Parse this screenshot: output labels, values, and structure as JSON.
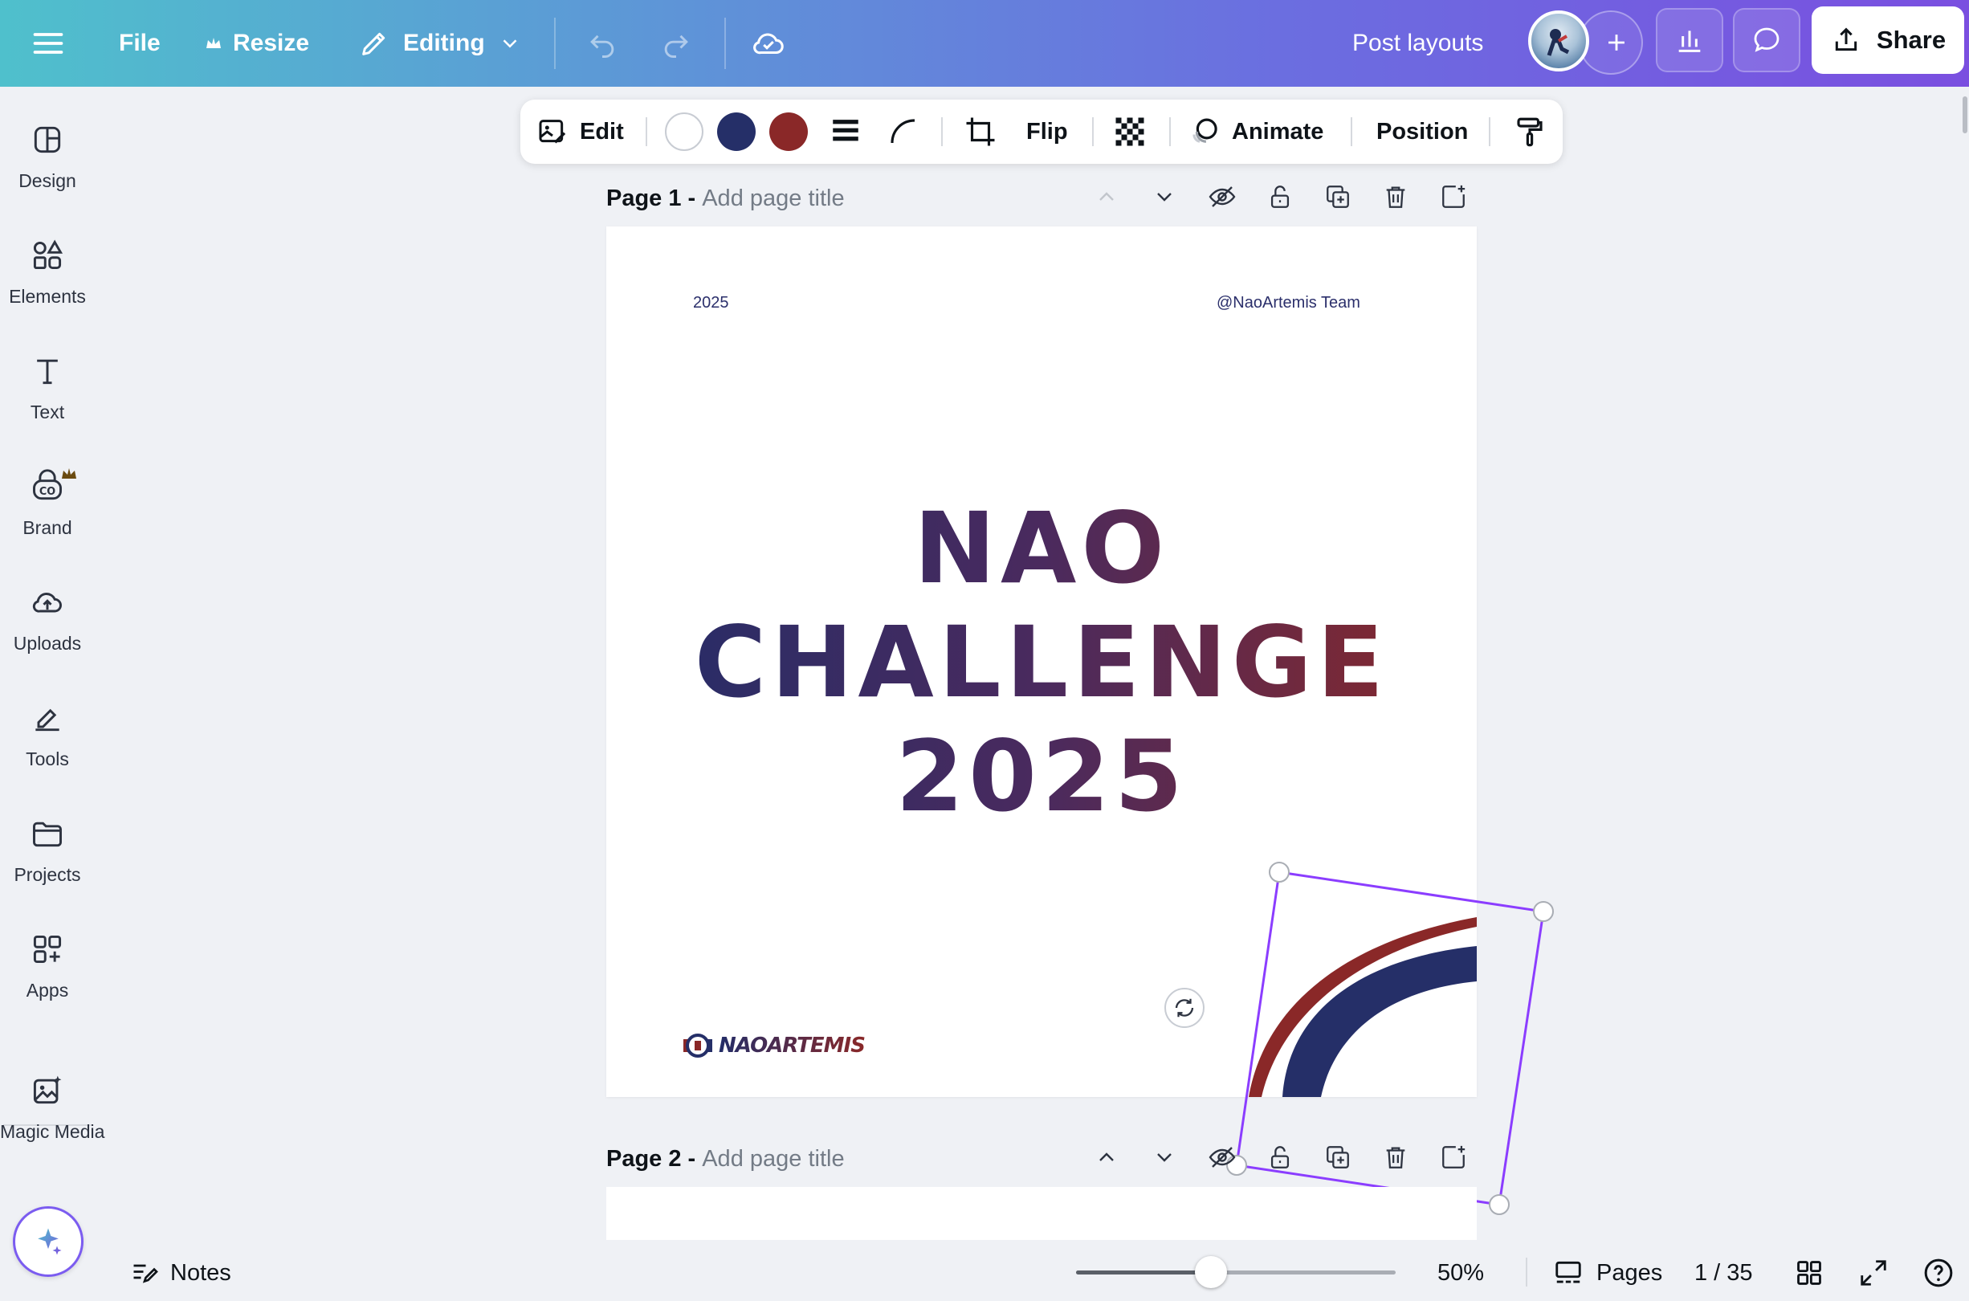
{
  "topbar": {
    "file_label": "File",
    "resize_label": "Resize",
    "editing_label": "Editing",
    "post_layouts_label": "Post layouts",
    "share_label": "Share"
  },
  "sidebar": {
    "items": [
      {
        "label": "Design",
        "icon": "design-icon"
      },
      {
        "label": "Elements",
        "icon": "elements-icon"
      },
      {
        "label": "Text",
        "icon": "text-icon"
      },
      {
        "label": "Brand",
        "icon": "brand-icon"
      },
      {
        "label": "Uploads",
        "icon": "uploads-icon"
      },
      {
        "label": "Tools",
        "icon": "tools-icon"
      },
      {
        "label": "Projects",
        "icon": "projects-icon"
      },
      {
        "label": "Apps",
        "icon": "apps-icon"
      },
      {
        "label": "Magic Media",
        "icon": "magic-media-icon"
      }
    ]
  },
  "context_toolbar": {
    "edit_label": "Edit",
    "colors": [
      "#ffffff",
      "#252f68",
      "#8a2828"
    ],
    "flip_label": "Flip",
    "animate_label": "Animate",
    "position_label": "Position"
  },
  "pages": [
    {
      "number_label": "Page 1 -",
      "title_placeholder": "Add page title"
    },
    {
      "number_label": "Page 2 -",
      "title_placeholder": "Add page title"
    }
  ],
  "design": {
    "year_small": "2025",
    "team_handle": "@NaoArtemis Team",
    "headline_line1": "NAO",
    "headline_line2": "CHALLENGE",
    "headline_line3": "2025",
    "logo_text": "NAOARTEMIS",
    "brand_navy": "#252f68",
    "brand_red": "#8a2828"
  },
  "bottombar": {
    "notes_label": "Notes",
    "zoom_label": "50%",
    "zoom_percent": 50,
    "pages_label": "Pages",
    "page_counter": "1 / 35"
  }
}
